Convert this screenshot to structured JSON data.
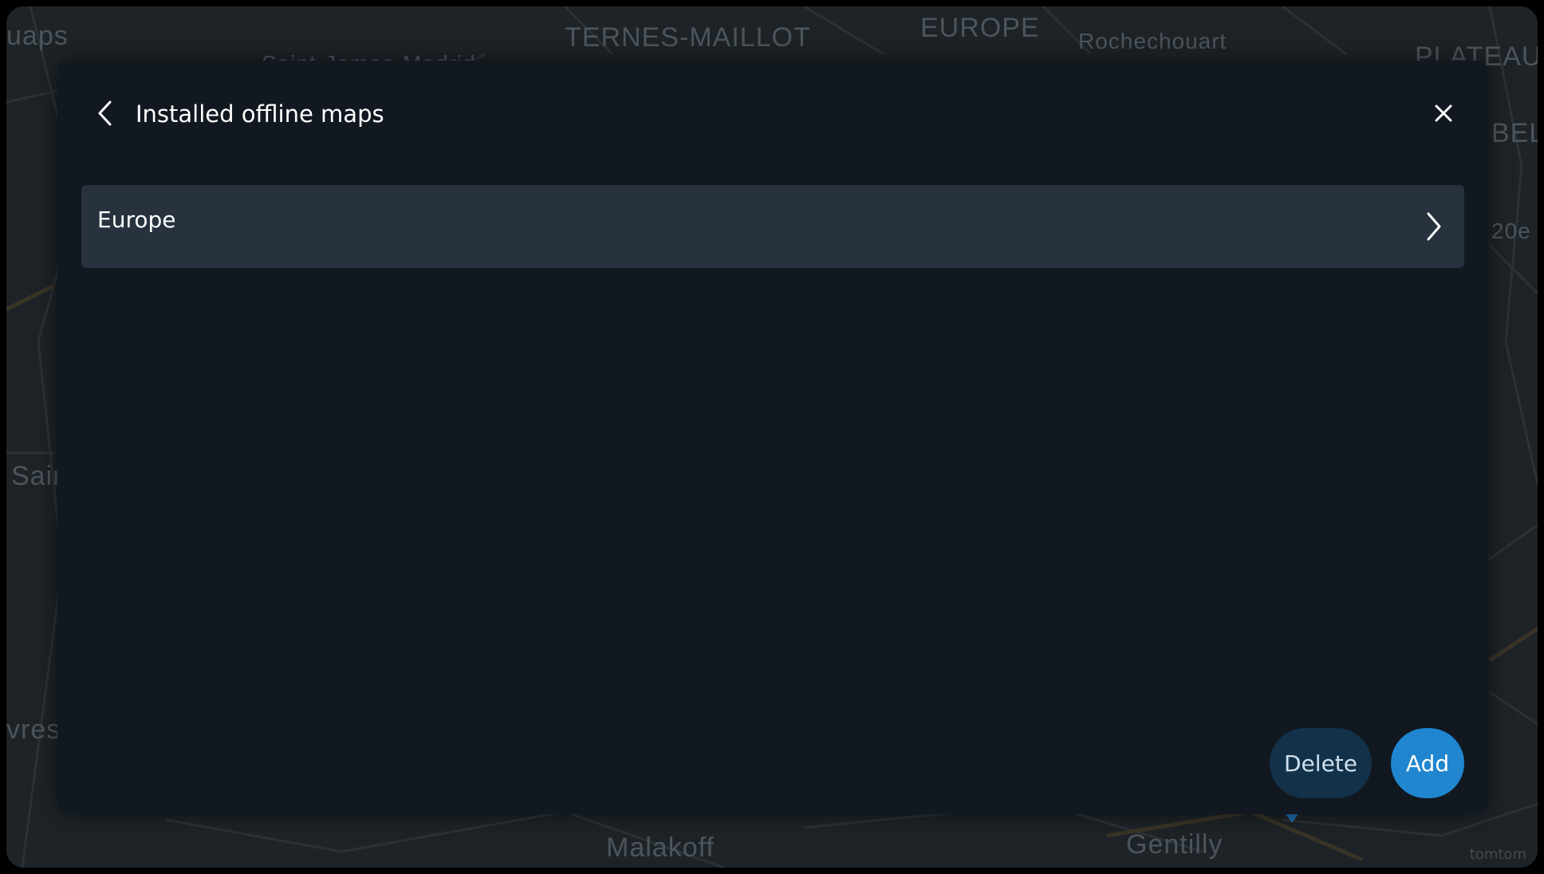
{
  "map": {
    "labels": [
      "uaps",
      "TERNES-MAILLOT",
      "Saint-James-Madrid",
      "EUROPE",
      "Rochechouart",
      "PLATEAU",
      "BEL",
      "20e",
      "Sain",
      "vres",
      "Malakoff",
      "Gentilly"
    ],
    "watermark": "tomtom"
  },
  "dialog": {
    "title": "Installed offline maps",
    "back_icon": "chevron-left-icon",
    "close_icon": "close-icon",
    "items": [
      {
        "label": "Europe",
        "icon": "chevron-right-icon"
      }
    ],
    "delete_label": "Delete",
    "add_label": "Add"
  },
  "colors": {
    "dialog_bg": "#111820",
    "list_item_bg": "#27323e",
    "add_button": "#1f86cf",
    "delete_button": "#13324a"
  }
}
